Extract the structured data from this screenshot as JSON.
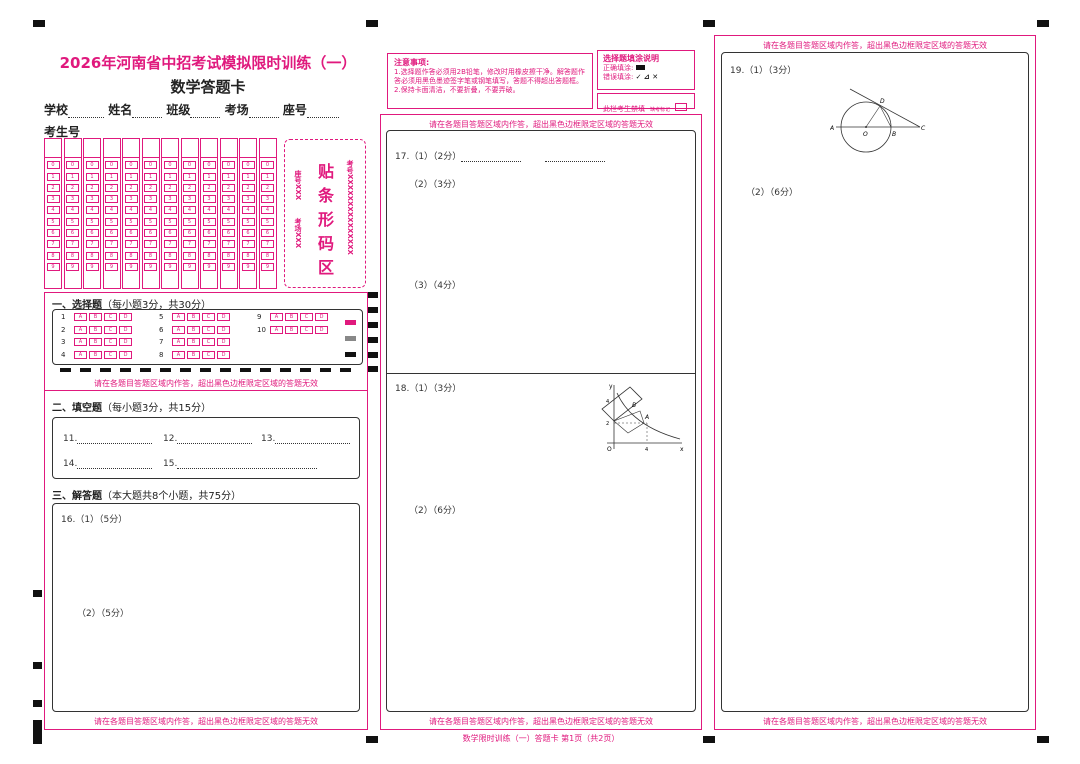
{
  "header": {
    "title": "2026年河南省中招考试模拟限时训练（一）",
    "subtitle": "数学答题卡",
    "fields": [
      "学校",
      "姓名",
      "班级",
      "考场",
      "座号"
    ],
    "exam_no_label": "考生号"
  },
  "barcode": {
    "title_chars": [
      "贴",
      "条",
      "形",
      "码",
      "区"
    ],
    "exam_no": "考号XXXXXXXXXXXXXXX",
    "seat": "座号XXX",
    "room": "考场XXX"
  },
  "notes": {
    "title": "注意事项:",
    "line1": "1.选择题作答必须用2B铅笔，修改时用橡皮擦干净。解答题作答必须用黑色墨迹签字笔或钢笔填写，答题不得超出答题框。",
    "line2": "2.保持卡面清洁，不要折叠，不要弄破。"
  },
  "fill_guide": {
    "title": "选择题填涂说明",
    "correct": "正确填涂:",
    "wrong": "错误填涂:",
    "wrong_marks": "✓ ⊿ ✕",
    "absent": "此栏考生禁填",
    "absent_mark": "缺考标记"
  },
  "digits": [
    "0",
    "1",
    "2",
    "3",
    "4",
    "5",
    "6",
    "7",
    "8",
    "9"
  ],
  "choice": {
    "heading": "一、选择题",
    "note": "（每小题3分，共30分）",
    "options": [
      "A",
      "B",
      "C",
      "D"
    ],
    "numbers": [
      "1",
      "2",
      "3",
      "4",
      "5",
      "6",
      "7",
      "8",
      "9",
      "10"
    ]
  },
  "fill": {
    "heading": "二、填空题",
    "note": "（每小题3分，共15分）",
    "items": [
      "11.",
      "12.",
      "13.",
      "14.",
      "15."
    ]
  },
  "solve": {
    "heading": "三、解答题",
    "note": "（本大题共8个小题，共75分）"
  },
  "q16": {
    "p1": "16.（1）（5分）",
    "p2": "（2）（5分）"
  },
  "q17": {
    "p1": "17.（1）（2分）",
    "p2": "（2）（3分）",
    "p3": "（3）（4分）"
  },
  "q18": {
    "p1": "18.（1）（3分）",
    "p2": "（2）（6分）"
  },
  "q19": {
    "p1": "19.（1）（3分）",
    "p2": "（2）（6分）"
  },
  "fig19": {
    "A": "A",
    "O": "O",
    "B": "B",
    "C": "C",
    "D": "D"
  },
  "fig18": {
    "y": "y",
    "x": "x",
    "O": "O",
    "A": "A",
    "B": "B",
    "t4y": "4",
    "t2y": "2",
    "t4x": "4"
  },
  "warning": "请在各题目答题区域内作答，超出黑色边框限定区域的答题无效",
  "footer": "数学限时训练（一）答题卡  第1页（共2页）",
  "accent_color": "#e0197d"
}
